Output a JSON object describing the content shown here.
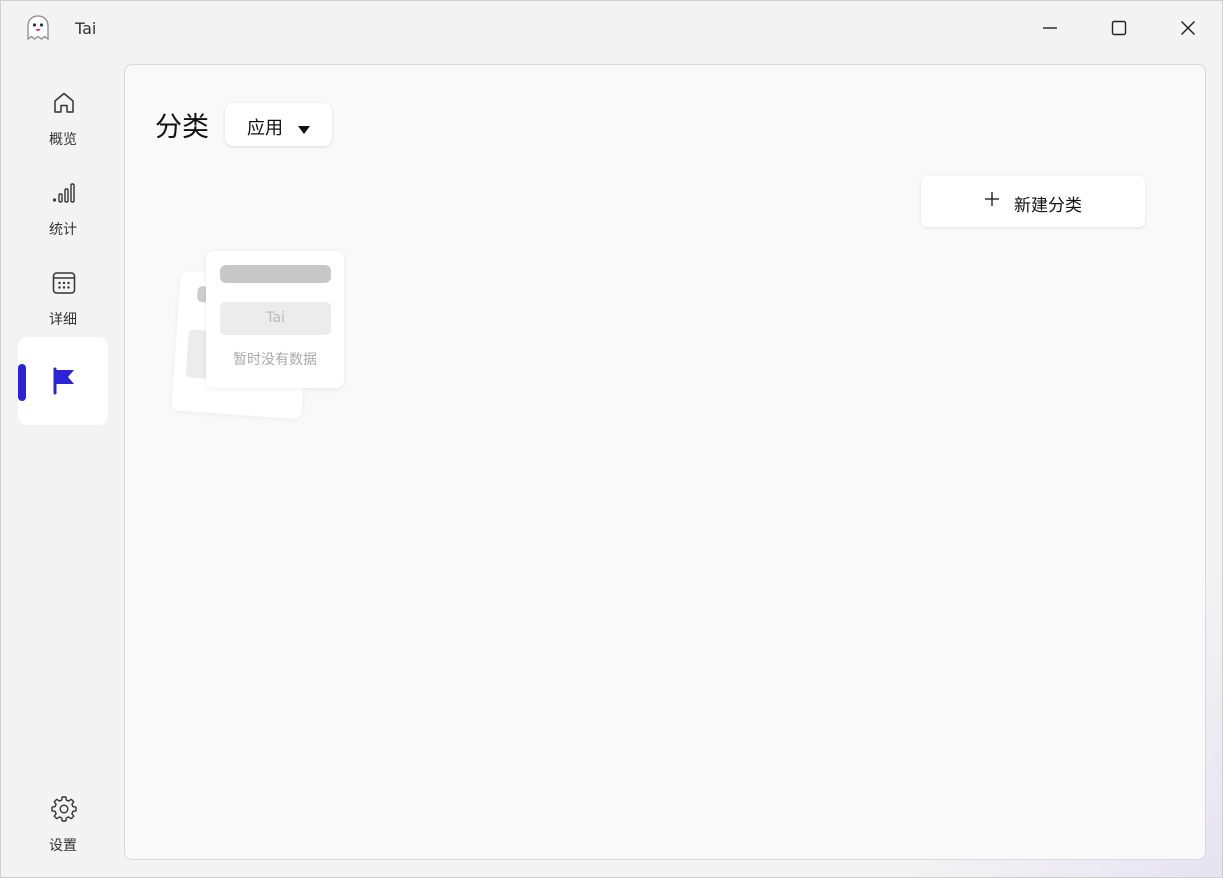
{
  "app": {
    "title": "Tai"
  },
  "sidebar": {
    "items": [
      {
        "label": "概览",
        "icon": "home-icon"
      },
      {
        "label": "统计",
        "icon": "stats-bars-icon"
      },
      {
        "label": "详细",
        "icon": "calendar-icon"
      },
      {
        "label": "",
        "icon": "flag-icon",
        "active": true
      },
      {
        "label": "设置",
        "icon": "gear-icon"
      }
    ]
  },
  "main": {
    "title": "分类",
    "type_select": {
      "value": "应用"
    },
    "new_button": {
      "label": "新建分类"
    },
    "empty_state": {
      "placeholder": "Tai",
      "message": "暂时没有数据"
    }
  },
  "colors": {
    "accent": "#2b24d6",
    "panel_bg": "#f9f9f9",
    "window_bg": "#f3f3f3"
  }
}
